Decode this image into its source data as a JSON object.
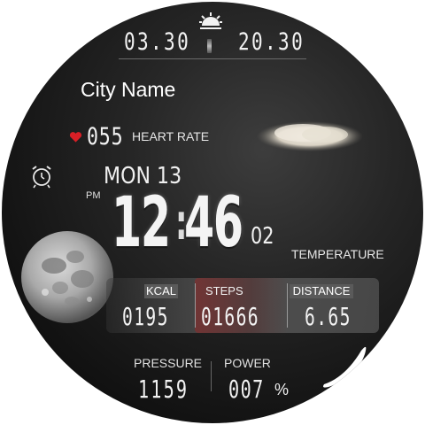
{
  "sun": {
    "icon": "sunrise-sunset-icon",
    "sunrise_time": "03.30",
    "sunset_time": "20.30"
  },
  "location": {
    "city": "City Name"
  },
  "heart_rate": {
    "value": "055",
    "label": "HEART RATE",
    "icon": "heart-icon",
    "icon_color": "#d81f26"
  },
  "weather": {
    "icon": "cloud-icon"
  },
  "alarm": {
    "icon": "alarm-clock-icon"
  },
  "date": {
    "day": "MON",
    "date_number": "13"
  },
  "time": {
    "ampm": "PM",
    "hours": "12",
    "separator": ":",
    "minutes": "46",
    "seconds": "02"
  },
  "temperature": {
    "label": "TEMPERATURE"
  },
  "moon": {
    "icon": "moon-phase-icon"
  },
  "stats": {
    "kcal": {
      "label": "KCAL",
      "value": "0195"
    },
    "steps": {
      "label": "STEPS",
      "value": "01666",
      "highlight_color": "#8e2b2b"
    },
    "distance": {
      "label": "DISTANCE",
      "value": "6.65"
    }
  },
  "pressure": {
    "label": "PRESSURE",
    "value": "1159"
  },
  "power": {
    "label": "POWER",
    "value": "007",
    "unit": "%"
  },
  "colors": {
    "face_background": "#1c1c1c",
    "text": "#f2f2f2"
  }
}
